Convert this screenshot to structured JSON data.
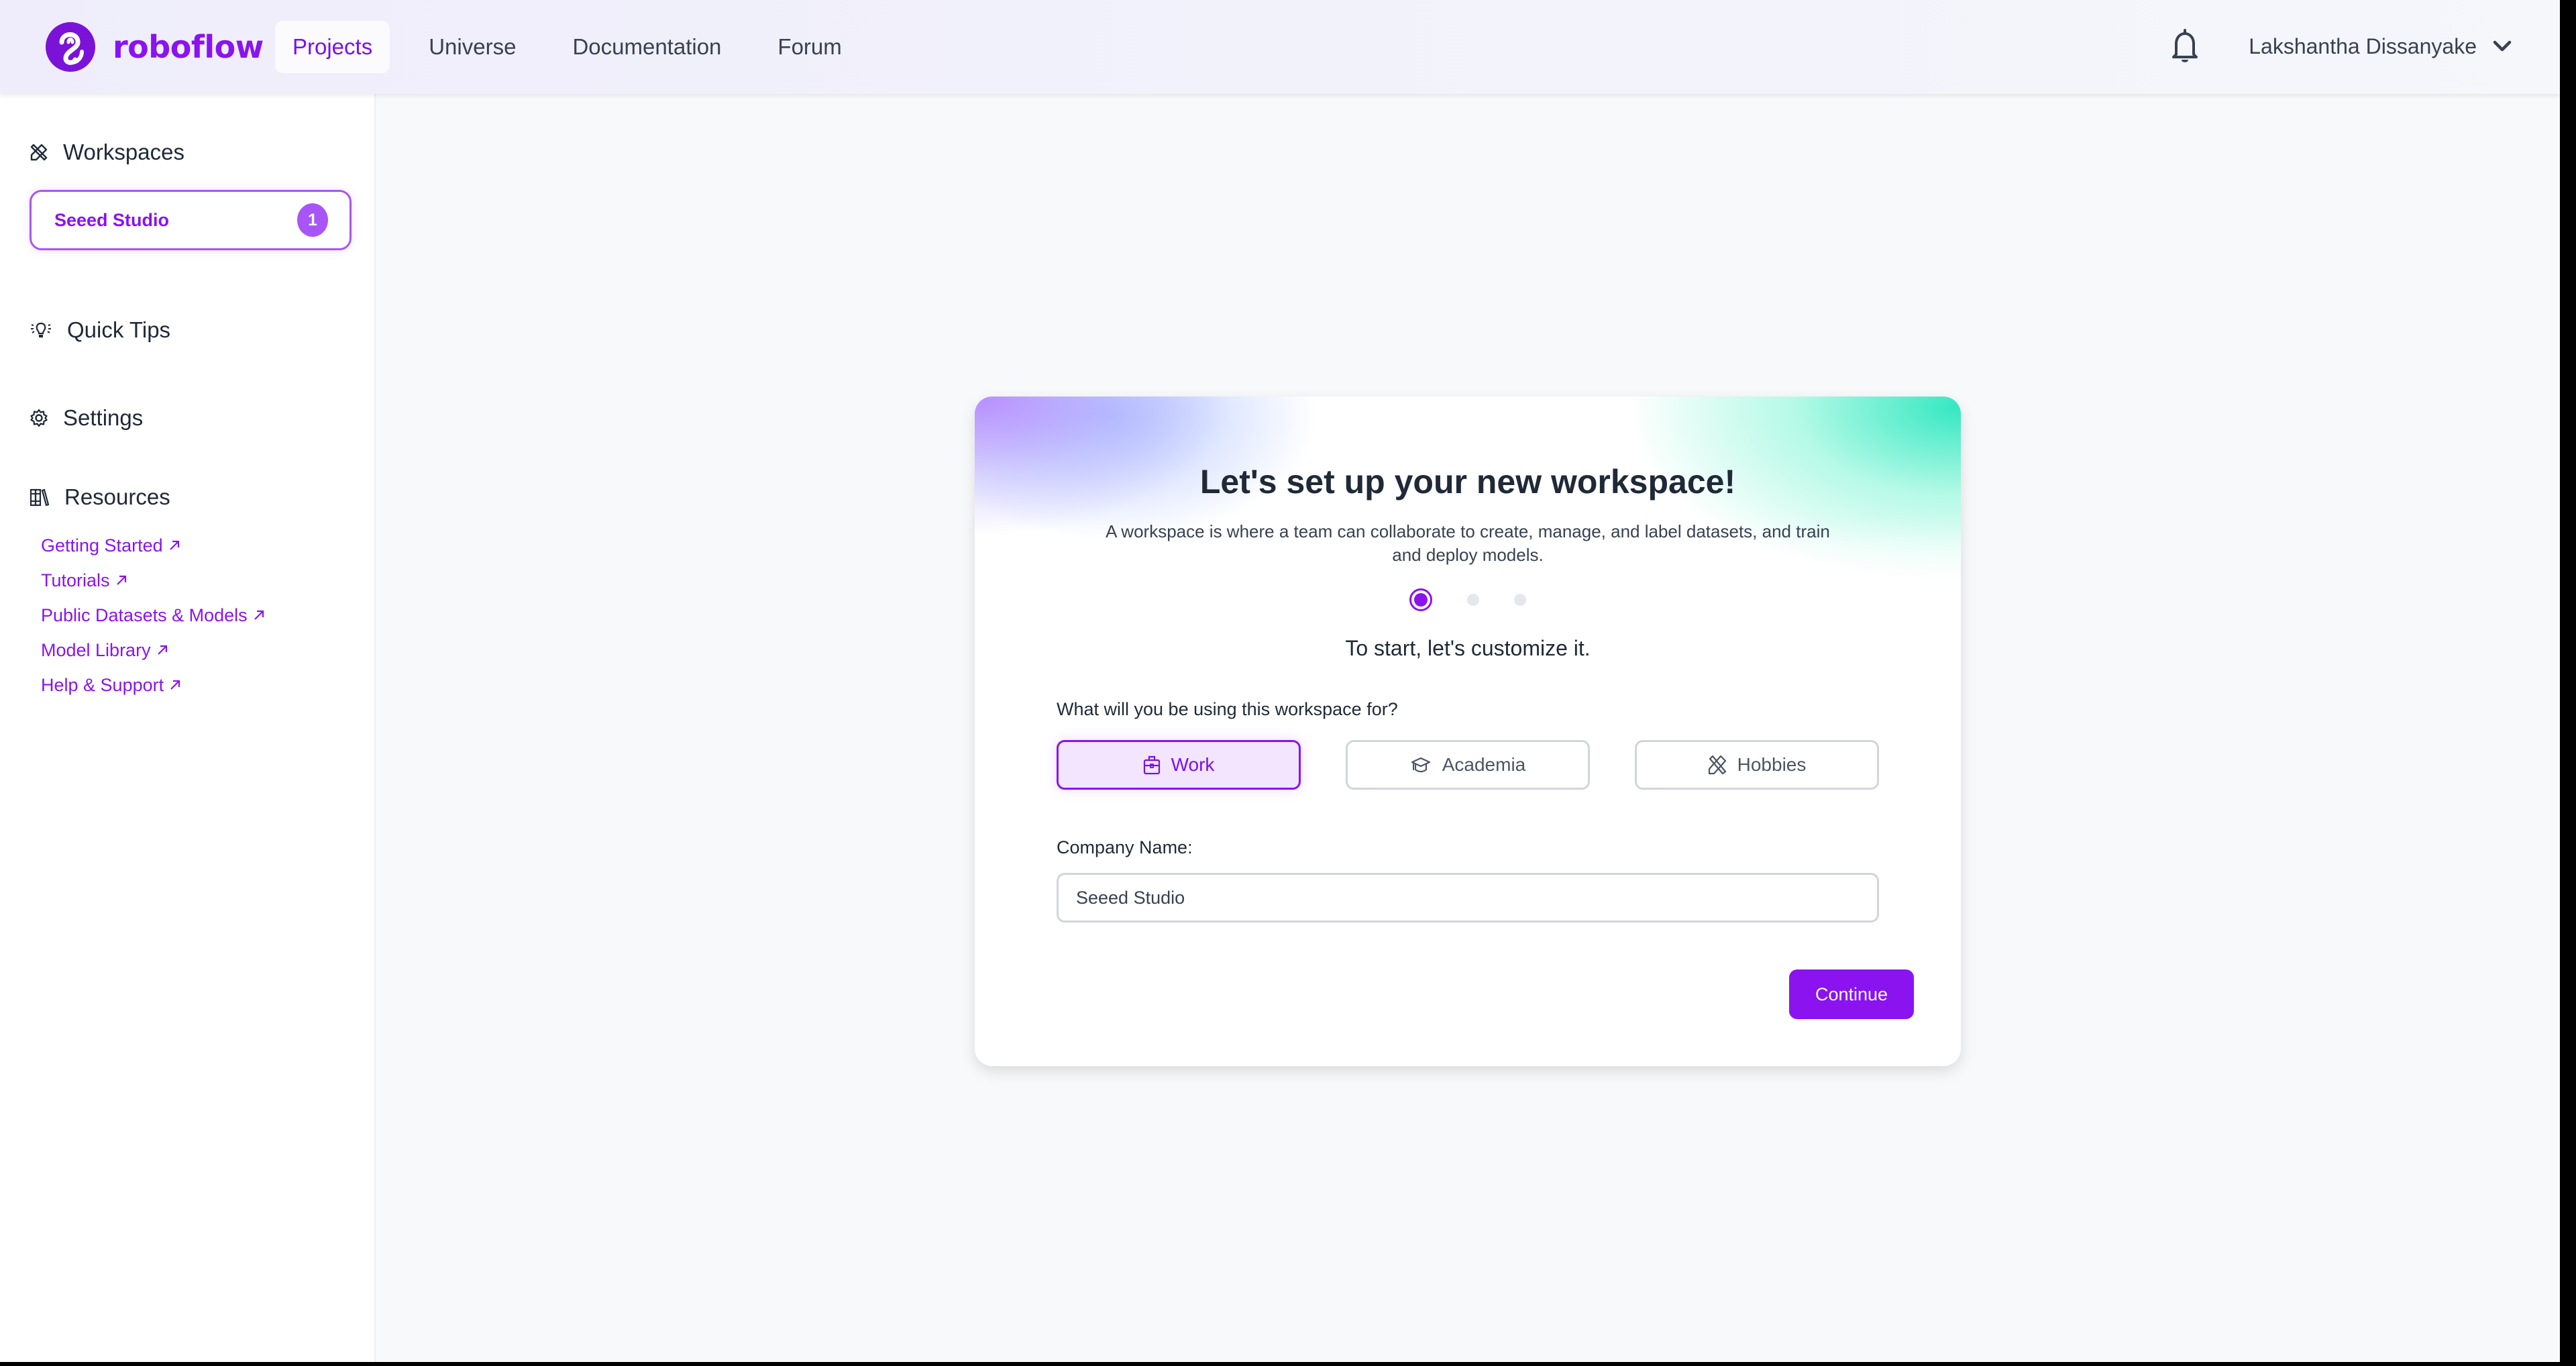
{
  "header": {
    "logo_text": "roboflow",
    "nav": [
      {
        "label": "Projects",
        "active": true
      },
      {
        "label": "Universe",
        "active": false
      },
      {
        "label": "Documentation",
        "active": false
      },
      {
        "label": "Forum",
        "active": false
      }
    ],
    "user_name": "Lakshantha Dissanyake",
    "icons": {
      "notifications": "bell-icon",
      "user_menu": "chevron-down-icon"
    }
  },
  "sidebar": {
    "workspaces_label": "Workspaces",
    "workspace": {
      "name": "Seeed Studio",
      "badge": "1"
    },
    "quick_tips_label": "Quick Tips",
    "settings_label": "Settings",
    "resources_label": "Resources",
    "resources": [
      {
        "label": "Getting Started"
      },
      {
        "label": "Tutorials"
      },
      {
        "label": "Public Datasets & Models"
      },
      {
        "label": "Model Library"
      },
      {
        "label": "Help & Support"
      }
    ]
  },
  "setup_card": {
    "title": "Let's set up your new workspace!",
    "subtitle": "A workspace is where a team can collaborate to create, manage, and label datasets, and train and deploy models.",
    "steps": {
      "current": 1,
      "total": 3
    },
    "step_title": "To start, let's customize it.",
    "question": "What will you be using this workspace for?",
    "options": [
      {
        "label": "Work",
        "icon": "briefcase-icon",
        "selected": true
      },
      {
        "label": "Academia",
        "icon": "graduation-cap-icon",
        "selected": false
      },
      {
        "label": "Hobbies",
        "icon": "tools-icon",
        "selected": false
      }
    ],
    "company_label": "Company Name:",
    "company_value": "Seeed Studio",
    "continue_label": "Continue"
  },
  "colors": {
    "brand": "#8a13f0",
    "selected_bg": "#f2e5fd",
    "badge": "#a855f7",
    "text": "#1f2937"
  }
}
